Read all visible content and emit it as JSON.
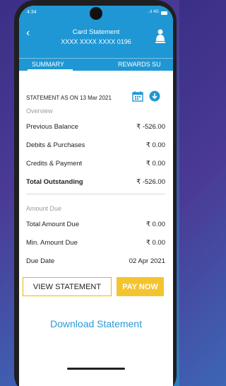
{
  "status_bar": {
    "time": "4:34",
    "signal": "..ıl 4G"
  },
  "header": {
    "back_icon": "chevron-left-icon",
    "title": "Card Statement",
    "card_number": "XXXX XXXX XXXX 0196",
    "profile_icon": "profile-icon"
  },
  "tabs": [
    {
      "label": "SUMMARY"
    },
    {
      "label": "REWARDS SU"
    }
  ],
  "statement": {
    "as_on": "STATEMENT AS ON 13 Mar 2021",
    "calendar_icon": "calendar-icon",
    "download_icon": "download-icon"
  },
  "overview": {
    "heading": "Overview",
    "rows": [
      {
        "label": "Previous Balance",
        "value": "₹ -526.00"
      },
      {
        "label": "Debits & Purchases",
        "value": "₹ 0.00"
      },
      {
        "label": "Credits & Payment",
        "value": "₹ 0.00"
      },
      {
        "label": "Total Outstanding",
        "value": "₹ -526.00"
      }
    ]
  },
  "amount_due": {
    "heading": "Amount Due",
    "rows": [
      {
        "label": "Total Amount Due",
        "value": "₹ 0.00"
      },
      {
        "label": "Min. Amount Due",
        "value": "₹ 0.00"
      },
      {
        "label": "Due Date",
        "value": "02 Apr 2021"
      }
    ]
  },
  "buttons": {
    "view_statement": "VIEW STATEMENT",
    "pay_now": "PAY NOW"
  },
  "download_link": "Download Statement",
  "colors": {
    "primary": "#1f97d4",
    "accent": "#f4c430"
  }
}
